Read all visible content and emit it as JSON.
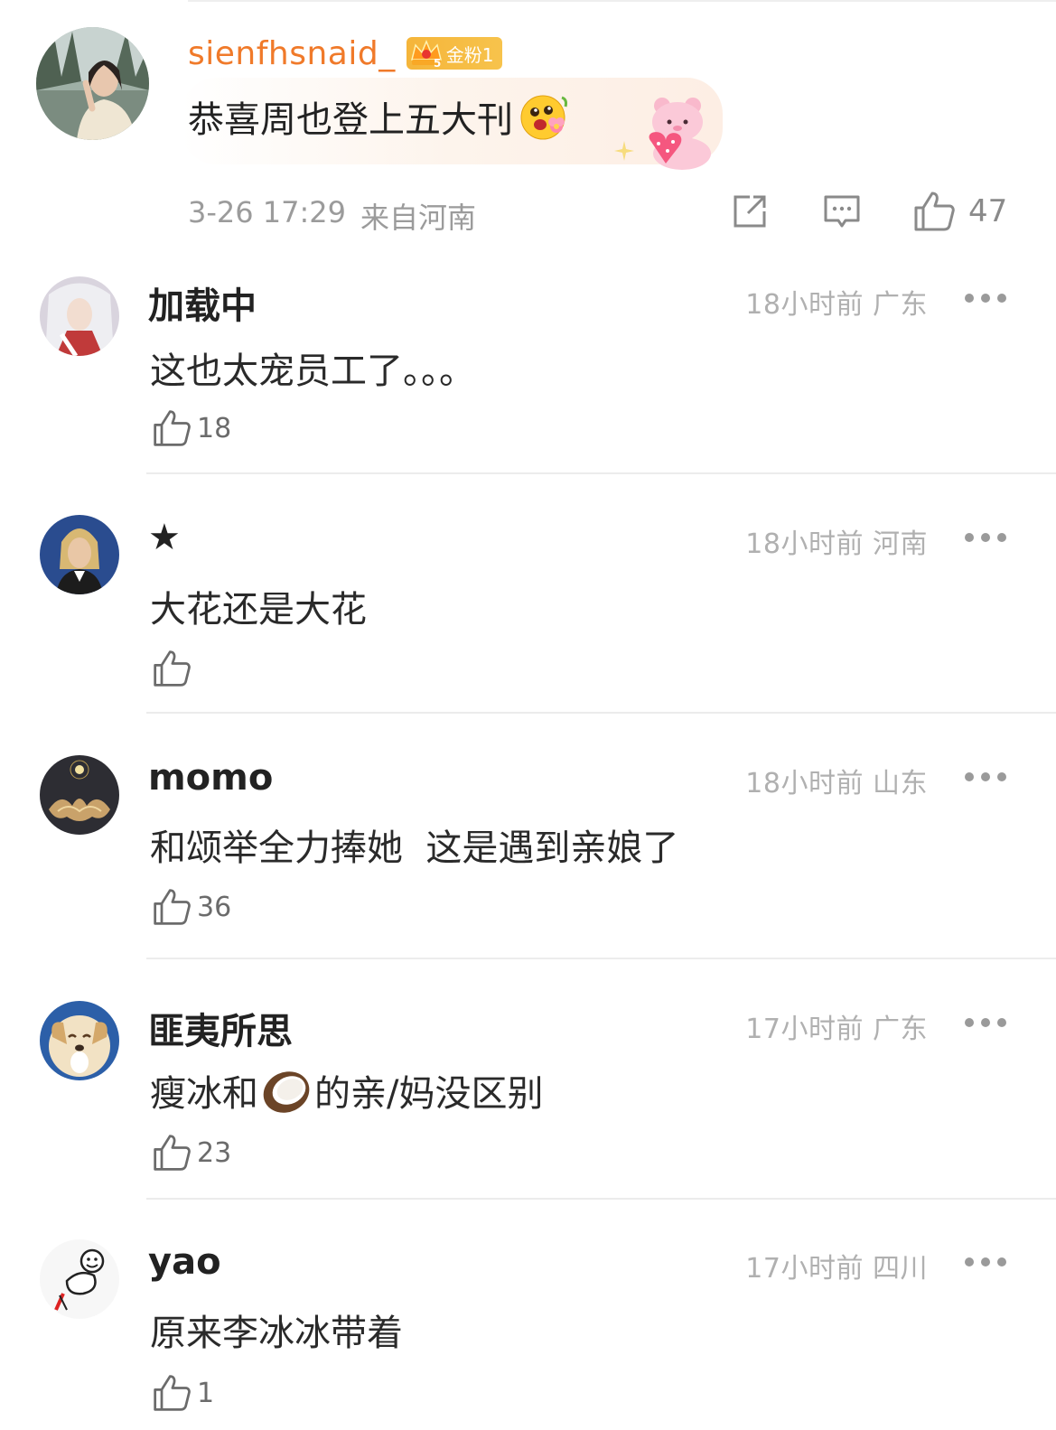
{
  "post": {
    "username": "sienfhsnaid_",
    "badge": {
      "level": "5",
      "label": "金粉1"
    },
    "text": "恭喜周也登上五大刊",
    "time": "3-26 17:29",
    "location": "来自河南",
    "like_count": "47",
    "icons": [
      "share-icon",
      "comment-icon",
      "like-icon"
    ]
  },
  "comments": [
    {
      "name": "加载中",
      "meta": "18小时前 广东",
      "text": "这也太宠员工了。。。",
      "likes": "18"
    },
    {
      "name": "★",
      "meta": "18小时前 河南",
      "text": "大花还是大花",
      "likes": ""
    },
    {
      "name": "momo",
      "meta": "18小时前 山东",
      "text": "和颂举全力捧她  这是遇到亲娘了",
      "likes": "36"
    },
    {
      "name": "匪夷所思",
      "meta": "17小时前 广东",
      "text_before": "瘦冰和",
      "text_after": "的亲/妈没区别",
      "likes": "23"
    },
    {
      "name": "yao",
      "meta": "17小时前 四川",
      "text": "原来李冰冰带着",
      "likes": "1"
    }
  ],
  "colors": {
    "username": "#f07a2a",
    "badge": "#f5b53a",
    "meta": "#9b9b9b"
  }
}
